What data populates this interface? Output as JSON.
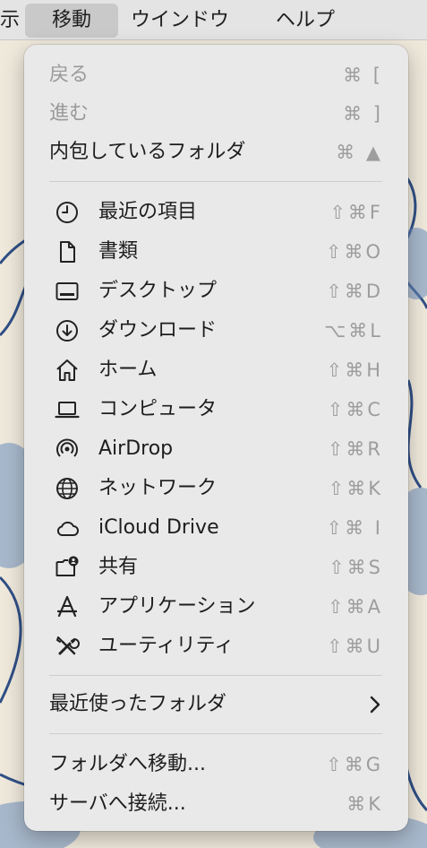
{
  "menubar": {
    "items": [
      {
        "label": "示"
      },
      {
        "label": "移動"
      },
      {
        "label": "ウインドウ"
      },
      {
        "label": "ヘルプ"
      }
    ]
  },
  "menu": {
    "nav": [
      {
        "label": "戻る",
        "shortcut": "⌘ [",
        "enabled": false
      },
      {
        "label": "進む",
        "shortcut": "⌘ ]",
        "enabled": false
      },
      {
        "label": "内包しているフォルダ",
        "shortcut": "⌘ ▲",
        "enabled": true
      }
    ],
    "places": [
      {
        "label": "最近の項目",
        "shortcut": "⇧⌘F",
        "icon": "clock-icon"
      },
      {
        "label": "書類",
        "shortcut": "⇧⌘O",
        "icon": "document-icon"
      },
      {
        "label": "デスクトップ",
        "shortcut": "⇧⌘D",
        "icon": "desktop-icon"
      },
      {
        "label": "ダウンロード",
        "shortcut": "⌥⌘L",
        "icon": "download-icon"
      },
      {
        "label": "ホーム",
        "shortcut": "⇧⌘H",
        "icon": "home-icon"
      },
      {
        "label": "コンピュータ",
        "shortcut": "⇧⌘C",
        "icon": "laptop-icon"
      },
      {
        "label": "AirDrop",
        "shortcut": "⇧⌘R",
        "icon": "airdrop-icon"
      },
      {
        "label": "ネットワーク",
        "shortcut": "⇧⌘K",
        "icon": "globe-icon"
      },
      {
        "label": "iCloud Drive",
        "shortcut": "⇧⌘ I",
        "icon": "cloud-icon"
      },
      {
        "label": "共有",
        "shortcut": "⇧⌘S",
        "icon": "shared-folder-icon"
      },
      {
        "label": "アプリケーション",
        "shortcut": "⇧⌘A",
        "icon": "applications-icon"
      },
      {
        "label": "ユーティリティ",
        "shortcut": "⇧⌘U",
        "icon": "utilities-icon"
      }
    ],
    "recent_folders": {
      "label": "最近使ったフォルダ",
      "icon": "chevron-right-icon"
    },
    "goto_folder": {
      "label": "フォルダへ移動...",
      "shortcut": "⇧⌘G"
    },
    "connect_server": {
      "label": "サーバへ接続...",
      "shortcut": "⌘K"
    }
  },
  "colors": {
    "menu_bg": "#e9e9e9",
    "menubar_active": "#c9c9c9",
    "disabled_text": "#9a9a9a",
    "shortcut_text": "#9d9d9d",
    "wallpaper_ink": "#2f4f86"
  }
}
